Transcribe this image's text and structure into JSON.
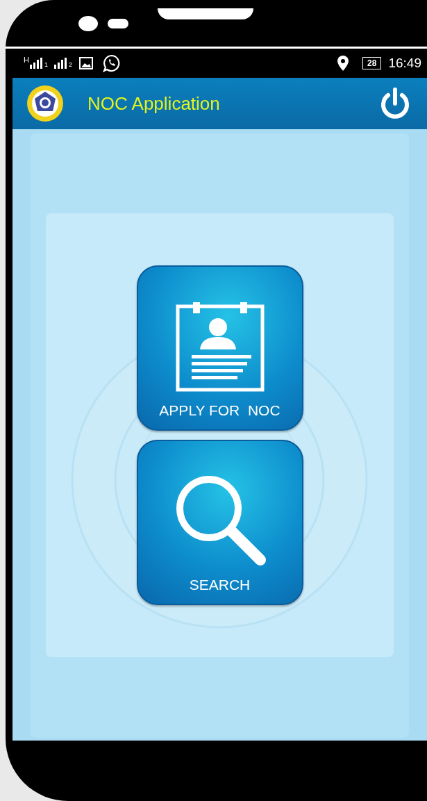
{
  "status_bar": {
    "network_label": "H",
    "sim_labels": [
      "1",
      "2"
    ],
    "battery": "28",
    "time": "16:49"
  },
  "app_bar": {
    "title": "NOC Application"
  },
  "actions": [
    {
      "kind": "apply",
      "label": "APPLY FOR  NOC"
    },
    {
      "kind": "search",
      "label": "SEARCH"
    }
  ]
}
